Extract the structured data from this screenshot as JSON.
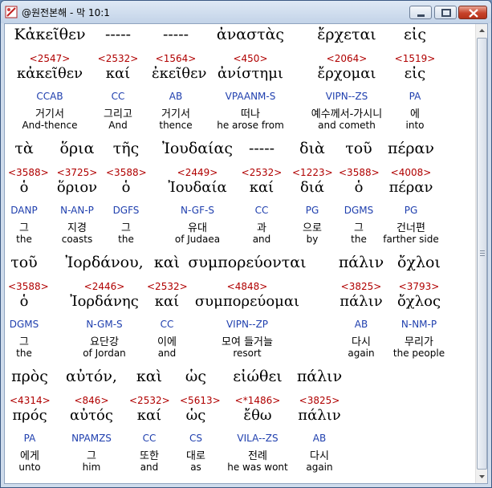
{
  "window": {
    "title": "@원전본해 - 막 10:1",
    "icon": "app-icon",
    "buttons": {
      "minimize": "minimize-icon",
      "maximize": "maximize-icon",
      "close": "close-icon"
    }
  },
  "rows": [
    [
      {
        "greek": "Κἀκεῖθεν",
        "strong": "<2547>",
        "lemma": "κἀκεῖθεν",
        "parse": "CCAB",
        "kor": "거기서",
        "eng": "And-thence"
      },
      {
        "greek": "-----",
        "strong": "<2532>",
        "lemma": "καί",
        "parse": "CC",
        "kor": "그리고",
        "eng": "And"
      },
      {
        "greek": "-----",
        "strong": "<1564>",
        "lemma": "ἐκεῖθεν",
        "parse": "AB",
        "kor": "거기서",
        "eng": "thence"
      },
      {
        "greek": "ἀναστὰς",
        "strong": "<450>",
        "lemma": "ἀνίστημι",
        "parse": "VPAANM-S",
        "kor": "떠나",
        "eng": "he arose from"
      },
      {
        "greek": "ἔρχεται",
        "strong": "<2064>",
        "lemma": "ἔρχομαι",
        "parse": "VIPN--ZS",
        "kor": "예수께서-가시니",
        "eng": "and cometh"
      },
      {
        "greek": "εἰς",
        "strong": "<1519>",
        "lemma": "εἰς",
        "parse": "PA",
        "kor": "에",
        "eng": "into"
      }
    ],
    [
      {
        "greek": "τὰ",
        "strong": "<3588>",
        "lemma": "ὁ",
        "parse": "DANP",
        "kor": "그",
        "eng": "the"
      },
      {
        "greek": "ὅρια",
        "strong": "<3725>",
        "lemma": "ὅριον",
        "parse": "N-AN-P",
        "kor": "지경",
        "eng": "coasts"
      },
      {
        "greek": "τῆς",
        "strong": "<3588>",
        "lemma": "ὁ",
        "parse": "DGFS",
        "kor": "그",
        "eng": "the"
      },
      {
        "greek": "Ἰουδαίας",
        "strong": "<2449>",
        "lemma": "Ἰουδαία",
        "parse": "N-GF-S",
        "kor": "유대",
        "eng": "of Judaea"
      },
      {
        "greek": "-----",
        "strong": "<2532>",
        "lemma": "καί",
        "parse": "CC",
        "kor": "과",
        "eng": "and"
      },
      {
        "greek": "διὰ",
        "strong": "<1223>",
        "lemma": "διά",
        "parse": "PG",
        "kor": "으로",
        "eng": "by"
      },
      {
        "greek": "τοῦ",
        "strong": "<3588>",
        "lemma": "ὁ",
        "parse": "DGMS",
        "kor": "그",
        "eng": "the"
      },
      {
        "greek": "πέραν",
        "strong": "<4008>",
        "lemma": "πέραν",
        "parse": "PG",
        "kor": "건너편",
        "eng": "farther side"
      }
    ],
    [
      {
        "greek": "τοῦ",
        "strong": "<3588>",
        "lemma": "ὁ",
        "parse": "DGMS",
        "kor": "그",
        "eng": "the"
      },
      {
        "greek": "Ἰορδάνου,",
        "strong": "<2446>",
        "lemma": "Ἰορδάνης",
        "parse": "N-GM-S",
        "kor": "요단강",
        "eng": "of Jordan"
      },
      {
        "greek": "καὶ",
        "strong": "<2532>",
        "lemma": "καί",
        "parse": "CC",
        "kor": "이에",
        "eng": "and"
      },
      {
        "greek": "συμπορεύονται",
        "strong": "<4848>",
        "lemma": "συμπορεύομαι",
        "parse": "VIPN--ZP",
        "kor": "모여 들거늘",
        "eng": "resort"
      },
      {
        "greek": "πάλιν",
        "strong": "<3825>",
        "lemma": "πάλιν",
        "parse": "AB",
        "kor": "다시",
        "eng": "again"
      },
      {
        "greek": "ὄχλοι",
        "strong": "<3793>",
        "lemma": "ὄχλος",
        "parse": "N-NM-P",
        "kor": "무리가",
        "eng": "the people"
      }
    ],
    [
      {
        "greek": "πρὸς",
        "strong": "<4314>",
        "lemma": "πρός",
        "parse": "PA",
        "kor": "에게",
        "eng": "unto"
      },
      {
        "greek": "αὐτόν,",
        "strong": "<846>",
        "lemma": "αὐτός",
        "parse": "NPAMZS",
        "kor": "그",
        "eng": "him"
      },
      {
        "greek": "καὶ",
        "strong": "<2532>",
        "lemma": "καί",
        "parse": "CC",
        "kor": "또한",
        "eng": "and"
      },
      {
        "greek": "ὡς",
        "strong": "<5613>",
        "lemma": "ὡς",
        "parse": "CS",
        "kor": "대로",
        "eng": "as"
      },
      {
        "greek": "εἰώθει",
        "strong": "<*1486>",
        "lemma": "ἔθω",
        "parse": "VILA--ZS",
        "kor": "전례",
        "eng": "he was wont"
      },
      {
        "greek": "πάλιν",
        "strong": "<3825>",
        "lemma": "πάλιν",
        "parse": "AB",
        "kor": "다시",
        "eng": "again"
      }
    ]
  ]
}
